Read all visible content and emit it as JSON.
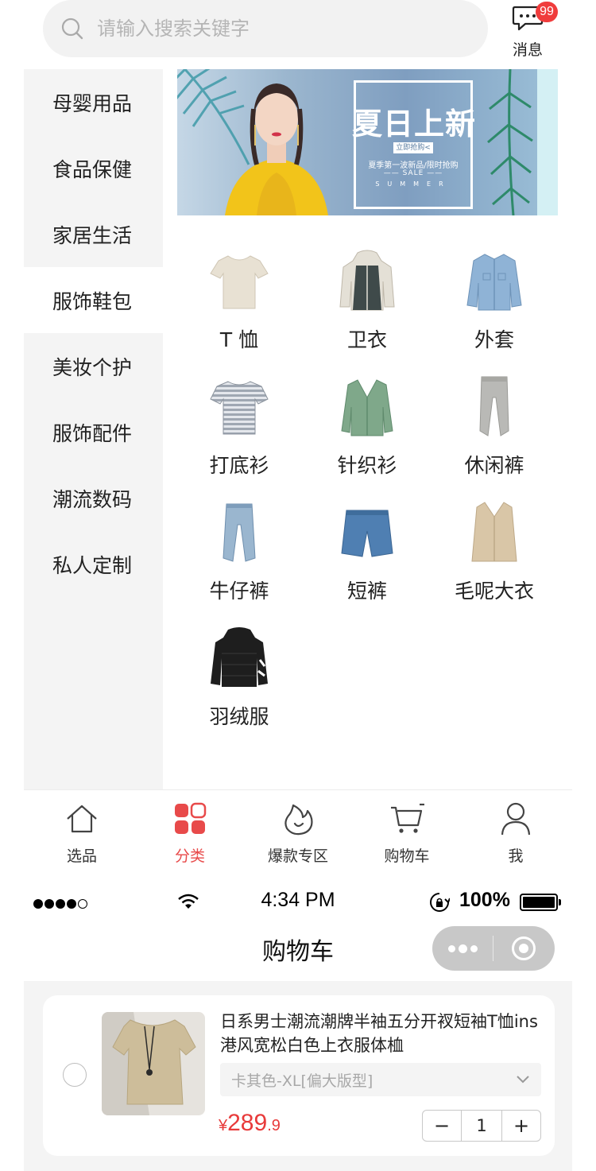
{
  "search": {
    "placeholder": "请输入搜索关键字"
  },
  "messages": {
    "label": "消息",
    "badge": "99"
  },
  "categories": [
    {
      "label": "母婴用品"
    },
    {
      "label": "食品保健"
    },
    {
      "label": "家居生活"
    },
    {
      "label": "服饰鞋包",
      "active": true
    },
    {
      "label": "美妆个护"
    },
    {
      "label": "服饰配件"
    },
    {
      "label": "潮流数码"
    },
    {
      "label": "私人定制"
    }
  ],
  "banner": {
    "title": "夏日上新",
    "button": "立即抢购<",
    "subtitle": "夏季第一波新品/限时抢购",
    "sale": "—— SALE ——",
    "summer": "SUMMER"
  },
  "products": [
    {
      "name": "T 恤",
      "icon": "tshirt-icon"
    },
    {
      "name": "卫衣",
      "icon": "hoodie-icon"
    },
    {
      "name": "外套",
      "icon": "denim-jacket-icon"
    },
    {
      "name": "打底衫",
      "icon": "striped-shirt-icon"
    },
    {
      "name": "针织衫",
      "icon": "cardigan-icon"
    },
    {
      "name": "休闲裤",
      "icon": "joggers-icon"
    },
    {
      "name": "牛仔裤",
      "icon": "jeans-icon"
    },
    {
      "name": "短裤",
      "icon": "shorts-icon"
    },
    {
      "name": "毛呢大衣",
      "icon": "wool-coat-icon"
    },
    {
      "name": "羽绒服",
      "icon": "down-jacket-icon"
    }
  ],
  "tabs": [
    {
      "label": "选品",
      "icon": "home-icon"
    },
    {
      "label": "分类",
      "icon": "category-icon",
      "active": true
    },
    {
      "label": "爆款专区",
      "icon": "flame-icon"
    },
    {
      "label": "购物车",
      "icon": "cart-icon"
    },
    {
      "label": "我",
      "icon": "user-icon"
    }
  ],
  "status_bar": {
    "time": "4:34 PM",
    "battery": "100%"
  },
  "cart_page": {
    "title": "购物车",
    "item": {
      "title": "日系男士潮流潮牌半袖五分开衩短袖T恤ins港风宽松白色上衣服体桖",
      "spec": "卡其色-XL[偏大版型]",
      "price_symbol": "¥",
      "price_int": "289",
      "price_dec": ".9",
      "quantity": "1",
      "minus": "−",
      "plus": "+"
    }
  },
  "colors": {
    "accent": "#e84a4a",
    "panel": "#f4f4f4",
    "badge": "#f03c3c",
    "price": "#e83a3a"
  }
}
